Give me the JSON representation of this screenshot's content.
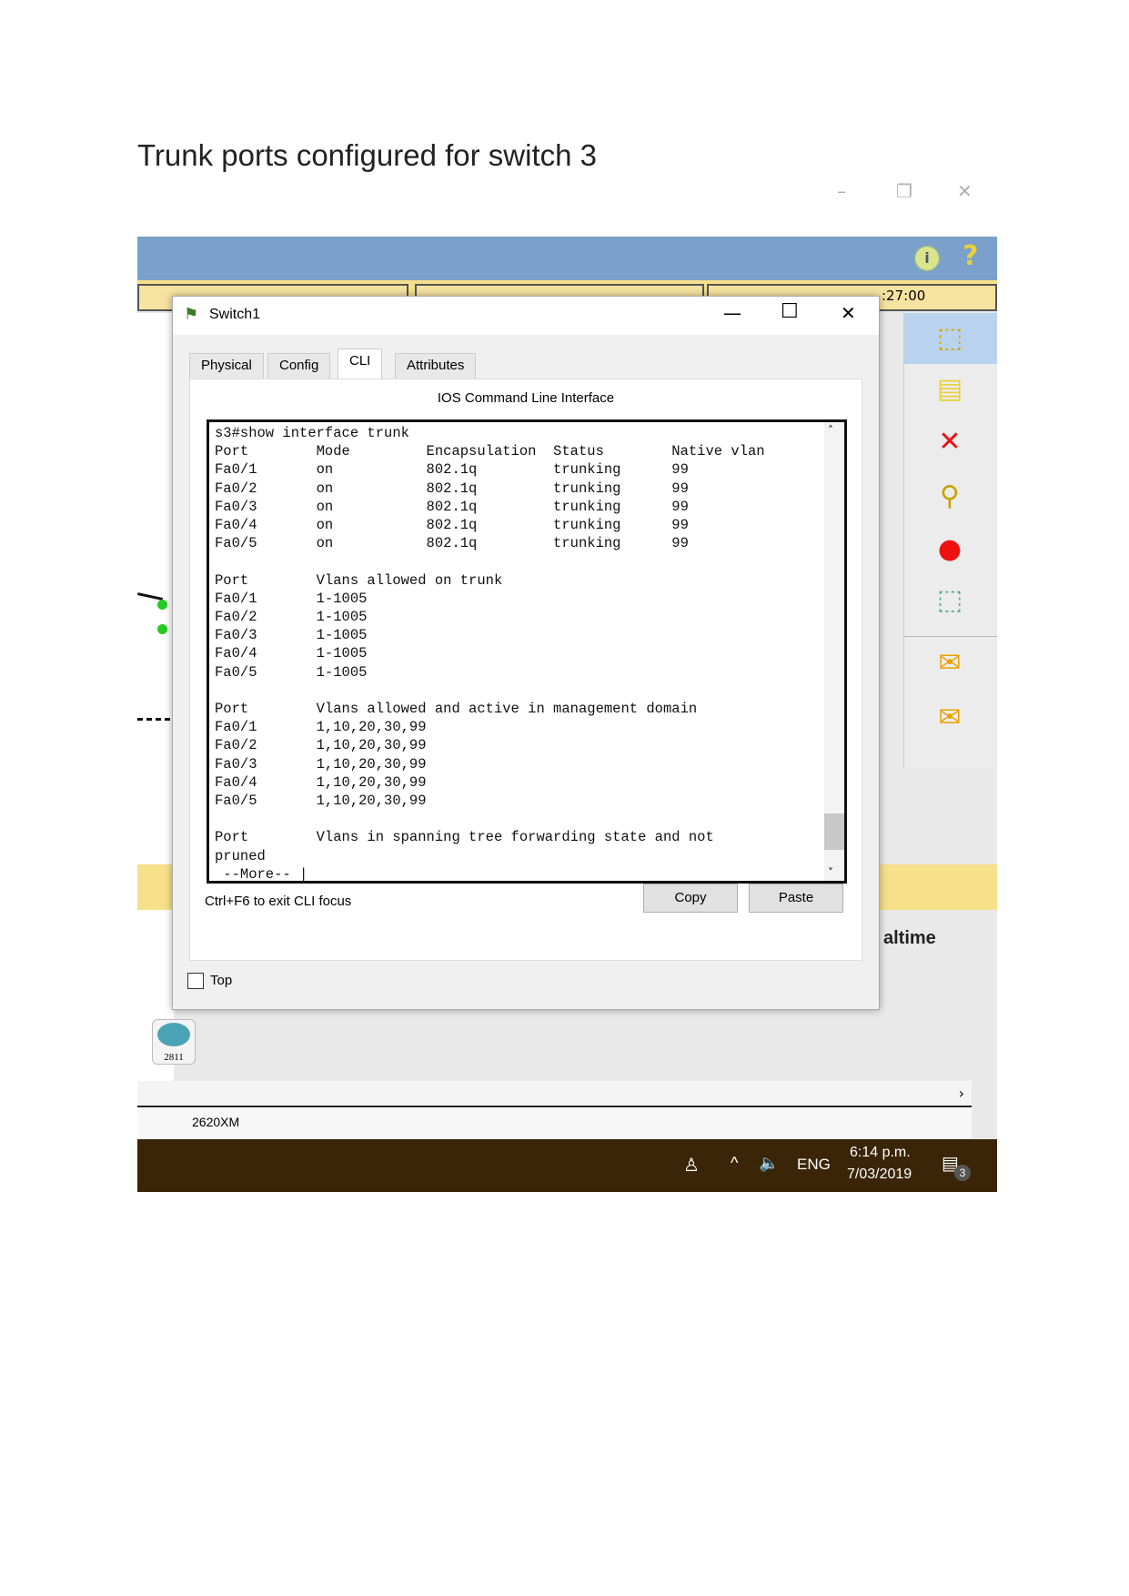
{
  "doc_title": "Trunk ports configured for switch 3",
  "outer_window": {
    "minimize": "–",
    "restore": "❐",
    "close": "✕"
  },
  "app": {
    "info_icon": "i",
    "help_icon": "?",
    "yellow_bar_time": ":27:00",
    "realtime_label": "altime",
    "device_label": "2811",
    "device_model_label": "2620XM"
  },
  "dialog": {
    "title": "Switch1",
    "minimize": "—",
    "maximize": "☐",
    "close": "✕",
    "tabs": [
      {
        "label": "Physical"
      },
      {
        "label": "Config"
      },
      {
        "label": "CLI",
        "active": true
      },
      {
        "label": "Attributes"
      }
    ],
    "heading": "IOS Command Line Interface",
    "terminal_lines": [
      "s3#show interface trunk",
      "Port        Mode         Encapsulation  Status        Native vlan",
      "Fa0/1       on           802.1q         trunking      99",
      "Fa0/2       on           802.1q         trunking      99",
      "Fa0/3       on           802.1q         trunking      99",
      "Fa0/4       on           802.1q         trunking      99",
      "Fa0/5       on           802.1q         trunking      99",
      "",
      "Port        Vlans allowed on trunk",
      "Fa0/1       1-1005",
      "Fa0/2       1-1005",
      "Fa0/3       1-1005",
      "Fa0/4       1-1005",
      "Fa0/5       1-1005",
      "",
      "Port        Vlans allowed and active in management domain",
      "Fa0/1       1,10,20,30,99",
      "Fa0/2       1,10,20,30,99",
      "Fa0/3       1,10,20,30,99",
      "Fa0/4       1,10,20,30,99",
      "Fa0/5       1,10,20,30,99",
      "",
      "Port        Vlans in spanning tree forwarding state and not",
      "pruned",
      " --More-- |"
    ],
    "hint": "Ctrl+F6 to exit CLI focus",
    "copy_label": "Copy",
    "paste_label": "Paste",
    "top_label": "Top",
    "top_checked": false
  },
  "taskbar": {
    "language": "ENG",
    "time": "6:14 p.m.",
    "date": "7/03/2019",
    "notifications": "3"
  }
}
